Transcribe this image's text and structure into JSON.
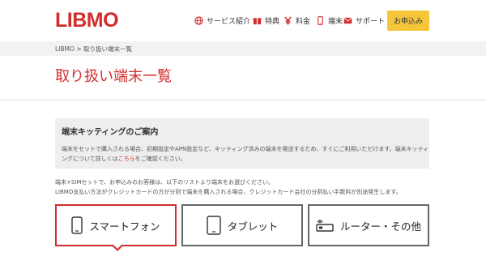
{
  "brand": {
    "logo_text": "LIBMO",
    "accent_color": "#d22d2d",
    "button_color": "#f5c63a"
  },
  "nav": {
    "items": [
      {
        "label": "サービス紹介",
        "icon": "globe-icon"
      },
      {
        "label": "特典",
        "icon": "gift-icon"
      },
      {
        "label": "料金",
        "icon": "yen-icon"
      },
      {
        "label": "端末",
        "icon": "smartphone-icon"
      },
      {
        "label": "サポート",
        "icon": "mail-icon"
      }
    ],
    "apply_label": "お申込み"
  },
  "breadcrumb": {
    "home": "LIBMO",
    "separator": ">",
    "current": "取り扱い端末一覧"
  },
  "page": {
    "title": "取り扱い端末一覧"
  },
  "info": {
    "title": "端末キッティングのご案内",
    "line1": "端末をセットで購入される場合、初期設定やAPN設定など、キッティング済みの端末を発送するため、すぐにご利用いただけます。端末キッティ",
    "line2_prefix": "ングについて詳しくは",
    "line2_link": "こちら",
    "line2_suffix": "をご確認ください。"
  },
  "notes": {
    "line1": "端末+SIMセットで、お申込みのお客様は、以下のリストより端末をお選びください。",
    "line2": "LIBMO支払い方法がクレジットカードの方が分割で端末を購入される場合、クレジットカード会社の分割払い手数料が別途発生します。"
  },
  "tabs": [
    {
      "label": "スマートフォン",
      "icon": "smartphone-icon",
      "active": true
    },
    {
      "label": "タブレット",
      "icon": "tablet-icon",
      "active": false
    },
    {
      "label": "ルーター・その他",
      "icon": "router-icon",
      "active": false
    }
  ]
}
